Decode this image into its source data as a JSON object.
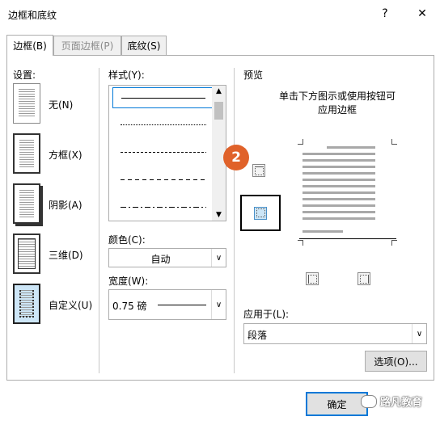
{
  "dialog": {
    "title": "边框和底纹",
    "help": "?",
    "close": "✕"
  },
  "tabs": [
    {
      "label": "边框(B)"
    },
    {
      "label": "页面边框(P)"
    },
    {
      "label": "底纹(S)"
    }
  ],
  "settings": {
    "heading": "设置:",
    "items": [
      {
        "label": "无(N)"
      },
      {
        "label": "方框(X)"
      },
      {
        "label": "阴影(A)"
      },
      {
        "label": "三维(D)"
      },
      {
        "label": "自定义(U)"
      }
    ]
  },
  "style": {
    "heading": "样式(Y):",
    "line_types": [
      "solid",
      "dotted",
      "dashed-fine",
      "dashed",
      "dash-dot"
    ]
  },
  "color": {
    "label": "颜色(C):",
    "value": "自动"
  },
  "width": {
    "label": "宽度(W):",
    "value": "0.75 磅"
  },
  "preview": {
    "heading": "预览",
    "hint_line1": "单击下方图示或使用按钮可",
    "hint_line2": "应用边框"
  },
  "apply_to": {
    "label": "应用于(L):",
    "value": "段落"
  },
  "options_button": "选项(O)...",
  "ok_button": "确定",
  "annotation": {
    "number": "2",
    "color": "#e0622a"
  },
  "watermark": "路凡教育"
}
